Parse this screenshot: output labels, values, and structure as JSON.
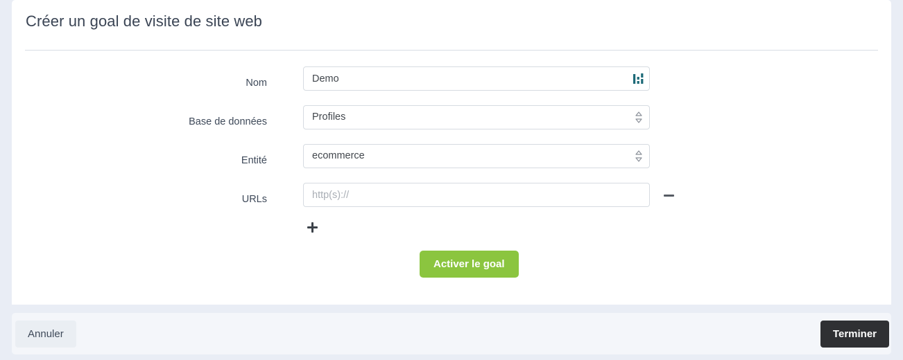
{
  "theme": {
    "page_background": "#e9edf5",
    "card_background": "#ffffff",
    "footer_background": "#f4f6fa",
    "accent_green": "#8bc53f",
    "dark_button": "#2f3033",
    "label_color": "#3f4a5a",
    "icon_teal": "#1d6a78",
    "border_color": "#d6dbe1"
  },
  "card": {
    "title": "Créer un goal de visite de site web"
  },
  "form": {
    "fields": [
      {
        "label": "Nom",
        "type": "text",
        "value": "Demo",
        "placeholder": "",
        "icon": "bar-chart-icon"
      },
      {
        "label": "Base de données",
        "type": "select",
        "value": "Profiles",
        "icon": "chevron-updown-icon"
      },
      {
        "label": "Entité",
        "type": "select",
        "value": "ecommerce",
        "icon": "chevron-updown-icon"
      },
      {
        "label": "URLs",
        "type": "text",
        "value": "",
        "placeholder": "http(s)://",
        "remove_icon": "minus-icon"
      }
    ],
    "add_url_icon": "plus-icon",
    "submit_label": "Activer le goal"
  },
  "footer": {
    "cancel_label": "Annuler",
    "finish_label": "Terminer"
  }
}
